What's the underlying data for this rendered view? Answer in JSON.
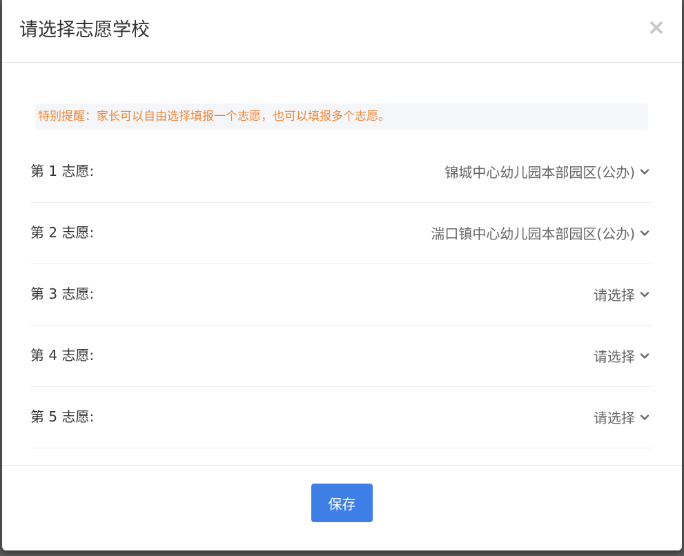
{
  "dialog": {
    "title": "请选择志愿学校",
    "close_label": "×"
  },
  "notice": "特别提醒：家长可以自由选择填报一个志愿，也可以填报多个志愿。",
  "choices": [
    {
      "label": "第 1 志愿:",
      "value": "锦城中心幼儿园本部园区(公办)"
    },
    {
      "label": "第 2 志愿:",
      "value": "湍口镇中心幼儿园本部园区(公办)"
    },
    {
      "label": "第 3 志愿:",
      "value": "请选择"
    },
    {
      "label": "第 4 志愿:",
      "value": "请选择"
    },
    {
      "label": "第 5 志愿:",
      "value": "请选择"
    }
  ],
  "footer": {
    "save_label": "保存"
  },
  "colors": {
    "notice_text": "#f0883a",
    "primary_button": "#3e7fe6"
  },
  "icons": {
    "close": "close-icon",
    "dropdown": "chevron-down-icon"
  }
}
